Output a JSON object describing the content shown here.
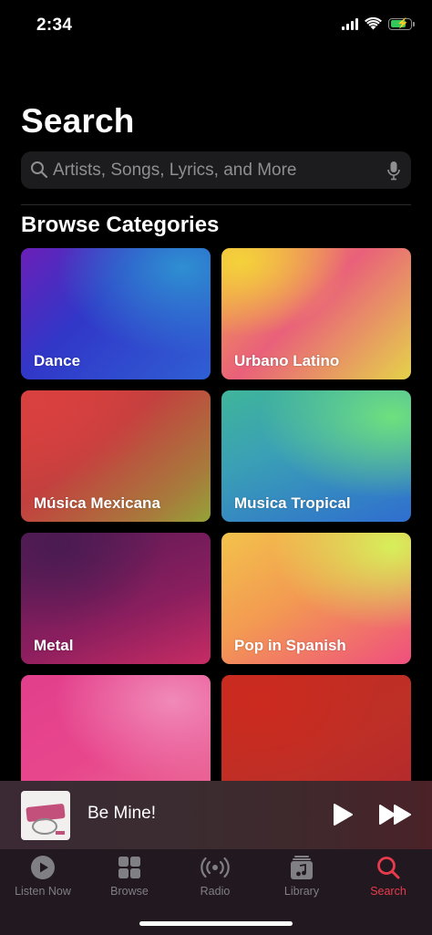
{
  "status_bar": {
    "time": "2:34",
    "signal_icon": "cellular-signal-icon",
    "wifi_icon": "wifi-icon",
    "battery_icon": "battery-charging-icon",
    "battery_color": "#34c759"
  },
  "page": {
    "title": "Search"
  },
  "search": {
    "placeholder": "Artists, Songs, Lyrics, and More",
    "value": "",
    "search_icon": "magnifying-glass-icon",
    "mic_icon": "microphone-icon"
  },
  "browse": {
    "title": "Browse Categories",
    "categories": [
      {
        "label": "Dance"
      },
      {
        "label": "Urbano Latino"
      },
      {
        "label": "Música Mexicana"
      },
      {
        "label": "Musica Tropical"
      },
      {
        "label": "Metal"
      },
      {
        "label": "Pop in Spanish"
      },
      {
        "label": ""
      },
      {
        "label": ""
      }
    ]
  },
  "now_playing": {
    "title": "Be Mine!",
    "play_icon": "play-icon",
    "next_icon": "forward-icon"
  },
  "tabs": [
    {
      "label": "Listen Now",
      "icon": "play-circle-icon",
      "active": false
    },
    {
      "label": "Browse",
      "icon": "grid-icon",
      "active": false
    },
    {
      "label": "Radio",
      "icon": "broadcast-icon",
      "active": false
    },
    {
      "label": "Library",
      "icon": "music-library-icon",
      "active": false
    },
    {
      "label": "Search",
      "icon": "search-icon",
      "active": true
    }
  ],
  "colors": {
    "accent": "#e83b4c",
    "background": "#000000",
    "search_field": "#1c1c1e",
    "inactive_tab": "#7f7f84"
  }
}
